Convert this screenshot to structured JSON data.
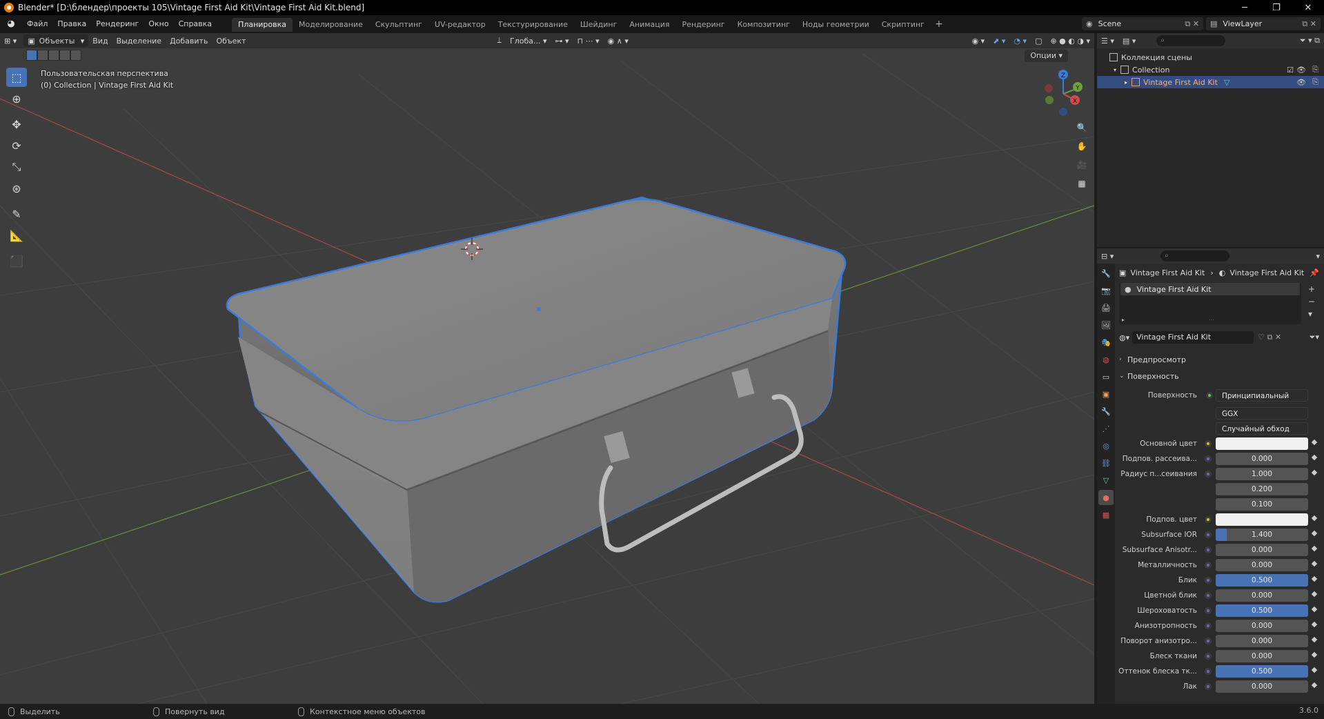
{
  "window": {
    "title": "Blender* [D:\\блендер\\проекты 105\\Vintage First Aid Kit\\Vintage First Aid Kit.blend]",
    "controls": [
      "─",
      "❐",
      "✕"
    ]
  },
  "menu": [
    "Файл",
    "Правка",
    "Рендеринг",
    "Окно",
    "Справка"
  ],
  "workspaces": [
    "Планировка",
    "Моделирование",
    "Скульптинг",
    "UV-редактор",
    "Текстурирование",
    "Шейдинг",
    "Анимация",
    "Рендеринг",
    "Композитинг",
    "Ноды геометрии",
    "Скриптинг"
  ],
  "active_workspace": "Планировка",
  "scene": "Scene",
  "view_layer": "ViewLayer",
  "viewport": {
    "mode": "Объекты",
    "header_menus": [
      "Вид",
      "Выделение",
      "Добавить",
      "Объект"
    ],
    "transform_orientation": "Глоба...",
    "options": "Опции",
    "info_line1": "Пользовательская перспектива",
    "info_line2": "(0) Collection | Vintage First Aid Kit",
    "gizmo_axes": [
      "Z",
      "Y",
      "X"
    ]
  },
  "outliner": {
    "rows": [
      {
        "label": "Коллекция сцены"
      },
      {
        "label": "Collection"
      },
      {
        "label": "Vintage First Aid Kit"
      }
    ]
  },
  "properties": {
    "breadcrumb_object": "Vintage First Aid Kit",
    "breadcrumb_material": "Vintage First Aid Kit",
    "slot": "Vintage First Aid Kit",
    "material_name": "Vintage First Aid Kit",
    "panel_preview": "Предпросмотр",
    "panel_surface": "Поверхность",
    "surface_label": "Поверхность",
    "surface_value": "Принципиальный BSDF",
    "distribution": "GGX",
    "subsurface_method": "Случайный обход",
    "rows": [
      {
        "label": "Основной цвет",
        "value": "",
        "kind": "color"
      },
      {
        "label": "Подпов. рассеива...",
        "value": "0.000",
        "fill": 0
      },
      {
        "label": "Радиус п...сеивания",
        "value": "1.000",
        "fill": 0
      },
      {
        "label": "",
        "value": "0.200",
        "fill": 0
      },
      {
        "label": "",
        "value": "0.100",
        "fill": 0
      },
      {
        "label": "Подпов. цвет",
        "value": "",
        "kind": "color"
      },
      {
        "label": "Subsurface IOR",
        "value": "1.400",
        "fill": 0.12
      },
      {
        "label": "Subsurface Anisotr...",
        "value": "0.000",
        "fill": 0
      },
      {
        "label": "Металличность",
        "value": "0.000",
        "fill": 0
      },
      {
        "label": "Блик",
        "value": "0.500",
        "fill": 1.0
      },
      {
        "label": "Цветной блик",
        "value": "0.000",
        "fill": 0
      },
      {
        "label": "Шероховатость",
        "value": "0.500",
        "fill": 1.0
      },
      {
        "label": "Анизотропность",
        "value": "0.000",
        "fill": 0
      },
      {
        "label": "Поворот анизотро...",
        "value": "0.000",
        "fill": 0
      },
      {
        "label": "Блеск ткани",
        "value": "0.000",
        "fill": 0
      },
      {
        "label": "Оттенок блеска тк...",
        "value": "0.500",
        "fill": 1.0
      },
      {
        "label": "Лак",
        "value": "0.000",
        "fill": 0
      }
    ]
  },
  "statusbar": {
    "select": "Выделить",
    "rotate": "Повернуть вид",
    "context": "Контекстное меню объектов",
    "version": "3.6.0"
  },
  "colors": {
    "accent": "#4772b3",
    "selection_outline": "#3b7bdb",
    "grid_x": "#b04040",
    "grid_y": "#6b9a32"
  }
}
